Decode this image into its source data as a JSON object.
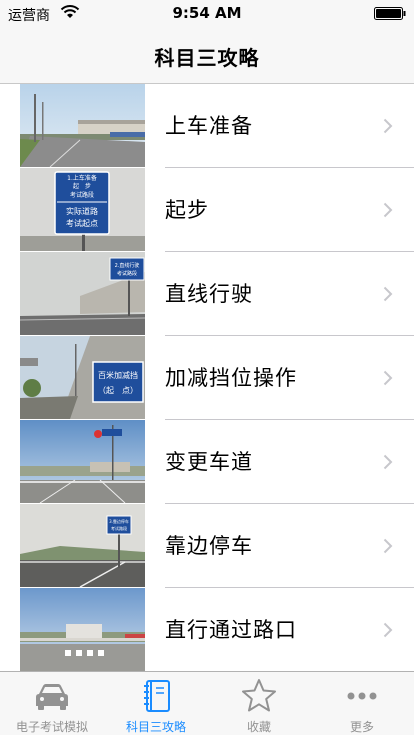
{
  "status_bar": {
    "carrier": "运营商",
    "time": "9:54 AM"
  },
  "nav": {
    "title": "科目三攻略"
  },
  "items": [
    {
      "label": "上车准备"
    },
    {
      "label": "起步",
      "sign_lines": [
        "1.上车准备",
        "起　步",
        "考试路段",
        "实际道路",
        "考试起点"
      ]
    },
    {
      "label": "直线行驶",
      "sign_lines": [
        "2.直线行驶",
        "考试路段"
      ]
    },
    {
      "label": "加减挡位操作",
      "sign_lines": [
        "百米加减挡",
        "（起　点）"
      ]
    },
    {
      "label": "变更车道"
    },
    {
      "label": "靠边停车",
      "sign_lines": [
        "3.靠边停车",
        "考试路段"
      ]
    },
    {
      "label": "直行通过路口"
    }
  ],
  "tabs": [
    {
      "label": "电子考试模拟",
      "icon": "car-icon",
      "active": false
    },
    {
      "label": "科目三攻略",
      "icon": "guide-book-icon",
      "active": true
    },
    {
      "label": "收藏",
      "icon": "star-icon",
      "active": false
    },
    {
      "label": "更多",
      "icon": "more-icon",
      "active": false
    }
  ],
  "colors": {
    "active_tab": "#1a8cff",
    "inactive_tab": "#929292",
    "sign_blue": "#1f4e9c"
  }
}
